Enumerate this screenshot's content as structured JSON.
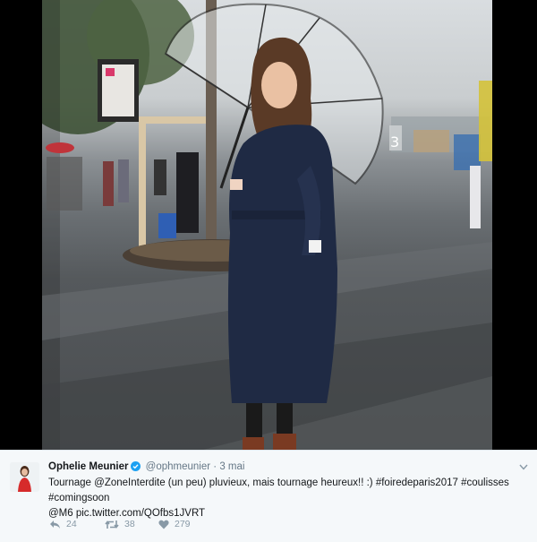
{
  "tweet": {
    "display_name": "Ophelie Meunier",
    "handle": "@ophmeunier",
    "separator": "·",
    "date": "3 mai",
    "text_line1": "Tournage @ZoneInterdite (un peu) pluvieux, mais tournage heureux!! :) #foiredeparis2017 #coulisses #comingsoon",
    "text_line2": "@M6 pic.twitter.com/QOfbs1JVRT",
    "verified": true
  },
  "actions": {
    "reply": {
      "icon": "reply-icon",
      "count": "24"
    },
    "retweet": {
      "icon": "retweet-icon",
      "count": "38"
    },
    "like": {
      "icon": "heart-icon",
      "count": "279"
    }
  },
  "photo": {
    "sign_text": "3"
  },
  "colors": {
    "verified_blue": "#1da1f2",
    "text_primary": "#14171a",
    "text_secondary": "#657786",
    "action_gray": "#8899a6",
    "tweet_bg": "#f5f8fa",
    "coat_navy": "#1f2a44",
    "avatar_red": "#d62b2b"
  }
}
